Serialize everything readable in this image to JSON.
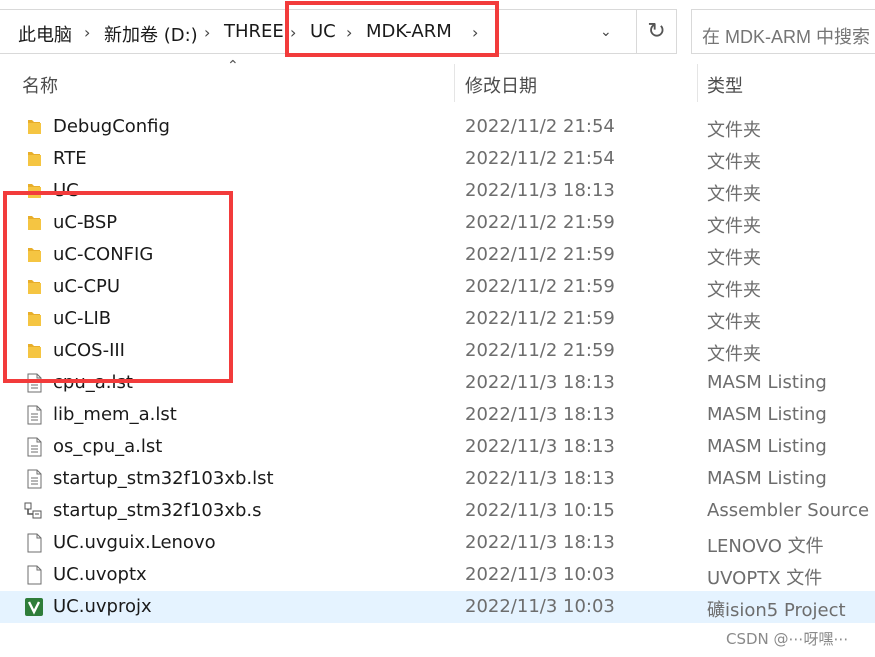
{
  "breadcrumb": {
    "items": [
      "此电脑",
      "新加卷 (D:)",
      "THREE",
      "UC",
      "MDK-ARM"
    ],
    "separator": "›"
  },
  "search": {
    "placeholder": "在 MDK-ARM 中搜索"
  },
  "columns": {
    "name": "名称",
    "date": "修改日期",
    "type": "类型"
  },
  "files": [
    {
      "name": "DebugConfig",
      "date": "2022/11/2 21:54",
      "type": "文件夹",
      "icon": "folder-icon"
    },
    {
      "name": "RTE",
      "date": "2022/11/2 21:54",
      "type": "文件夹",
      "icon": "folder-icon"
    },
    {
      "name": "UC",
      "date": "2022/11/3 18:13",
      "type": "文件夹",
      "icon": "folder-icon"
    },
    {
      "name": "uC-BSP",
      "date": "2022/11/2 21:59",
      "type": "文件夹",
      "icon": "folder-icon"
    },
    {
      "name": "uC-CONFIG",
      "date": "2022/11/2 21:59",
      "type": "文件夹",
      "icon": "folder-icon"
    },
    {
      "name": "uC-CPU",
      "date": "2022/11/2 21:59",
      "type": "文件夹",
      "icon": "folder-icon"
    },
    {
      "name": "uC-LIB",
      "date": "2022/11/2 21:59",
      "type": "文件夹",
      "icon": "folder-icon"
    },
    {
      "name": "uCOS-III",
      "date": "2022/11/2 21:59",
      "type": "文件夹",
      "icon": "folder-icon"
    },
    {
      "name": "cpu_a.lst",
      "date": "2022/11/3 18:13",
      "type": "MASM Listing",
      "icon": "text-file-icon"
    },
    {
      "name": "lib_mem_a.lst",
      "date": "2022/11/3 18:13",
      "type": "MASM Listing",
      "icon": "text-file-icon"
    },
    {
      "name": "os_cpu_a.lst",
      "date": "2022/11/3 18:13",
      "type": "MASM Listing",
      "icon": "text-file-icon"
    },
    {
      "name": "startup_stm32f103xb.lst",
      "date": "2022/11/3 18:13",
      "type": "MASM Listing",
      "icon": "text-file-icon"
    },
    {
      "name": "startup_stm32f103xb.s",
      "date": "2022/11/3 10:15",
      "type": "Assembler Source",
      "icon": "assembler-file-icon"
    },
    {
      "name": "UC.uvguix.Lenovo",
      "date": "2022/11/3 18:13",
      "type": "LENOVO 文件",
      "icon": "blank-file-icon"
    },
    {
      "name": "UC.uvoptx",
      "date": "2022/11/3 10:03",
      "type": "UVOPTX 文件",
      "icon": "blank-file-icon"
    },
    {
      "name": "UC.uvprojx",
      "date": "2022/11/3 10:03",
      "type": "礦ision5 Project",
      "icon": "keil-project-icon",
      "selected": true
    }
  ],
  "watermark": "CSDN @⋯呀嘿⋯",
  "colors": {
    "highlight": "#f23b3b",
    "folder": "#f5c542",
    "selection": "#e5f3ff"
  }
}
